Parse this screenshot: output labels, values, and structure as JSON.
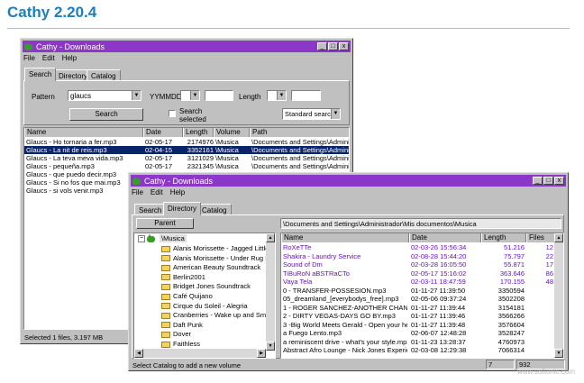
{
  "page": {
    "title": "Cathy 2.20.4",
    "watermark": "www.softonic.com"
  },
  "win1": {
    "title": "Cathy - Downloads",
    "menu": [
      "File",
      "Edit",
      "Help"
    ],
    "tabs": [
      "Search",
      "Directory",
      "Catalog"
    ],
    "search": {
      "pattern_label": "Pattern",
      "pattern_value": "glaucs",
      "date_label": "YYMMDD",
      "length_label": "Length",
      "search_button": "Search",
      "selected_label": "Search selected",
      "mode": "Standard search"
    },
    "columns": [
      "Name",
      "Date",
      "Length",
      "Volume",
      "Path"
    ],
    "rows": [
      {
        "name": "Glaucs - Ho tornaria a fer.mp3",
        "date": "02-05-17",
        "length": "2174976",
        "volume": "\\Musica",
        "path": "\\Documents and Settings\\Administr",
        "selected": false
      },
      {
        "name": "Glaucs - La nit de reis.mp3",
        "date": "02-04-15",
        "length": "3352161",
        "volume": "\\Musica",
        "path": "\\Documents and Settings\\Administr",
        "selected": true
      },
      {
        "name": "Glaucs - La teva meva vida.mp3",
        "date": "02-05-17",
        "length": "3121029",
        "volume": "\\Musica",
        "path": "\\Documents and Settings\\Administr",
        "selected": false
      },
      {
        "name": "Glaucs - pequeña.mp3",
        "date": "02-05-17",
        "length": "2321345",
        "volume": "\\Musica",
        "path": "\\Documents and Settings\\Administr",
        "selected": false
      },
      {
        "name": "Glaucs - que puedo decir.mp3",
        "date": "",
        "length": "",
        "volume": "",
        "path": "",
        "selected": false
      },
      {
        "name": "Glaucs - Si no fos que mai.mp3",
        "date": "",
        "length": "",
        "volume": "",
        "path": "",
        "selected": false
      },
      {
        "name": "Glaucs - si vols venir.mp3",
        "date": "",
        "length": "",
        "volume": "",
        "path": "",
        "selected": false
      }
    ],
    "status": "Selected 1 files, 3.197 MB"
  },
  "win2": {
    "title": "Cathy - Downloads",
    "menu": [
      "File",
      "Edit",
      "Help"
    ],
    "tabs": [
      "Search",
      "Directory",
      "Catalog"
    ],
    "parent_button": "Parent",
    "path": "\\Documents and Settings\\Administrador\\Mis documentos\\Musica",
    "tree_root": "\\Musica",
    "tree": [
      "Alanis Morissette - Jagged Little Pill",
      "Alanis Morissette - Under Rug Swept",
      "American Beauty Soundtrack",
      "Berlin2001",
      "Bridget Jones Soundtrack",
      "Café Quijano",
      "Cirque du Soleil - Alegria",
      "Cranberries - Wake up and Smell the",
      "Daft Punk",
      "Dover",
      "Faithless"
    ],
    "columns": [
      "Name",
      "Date",
      "Length",
      "Files"
    ],
    "rows": [
      {
        "name": "RoXeTTe",
        "date": "02-03-26 15:56:34",
        "length": "51.216",
        "files": "12",
        "dir": true
      },
      {
        "name": "Shakira - Laundry Service",
        "date": "02-08-28 15:44:20",
        "length": "75.797",
        "files": "22",
        "dir": true
      },
      {
        "name": "Sound of Dm",
        "date": "02-03-28 16:05:50",
        "length": "55.871",
        "files": "17",
        "dir": true
      },
      {
        "name": "TiBuRoN aBSTRaCTo",
        "date": "02-05-17 15:16:02",
        "length": "363.646",
        "files": "86",
        "dir": true
      },
      {
        "name": "Vaya Tela",
        "date": "02-03-11 18:47:59",
        "length": "170.155",
        "files": "48",
        "dir": true
      },
      {
        "name": "0 - TRANSFER-POSSESION.mp3",
        "date": "01-11-27 11:39:50",
        "length": "3350594",
        "files": "",
        "dir": false
      },
      {
        "name": "05_dreamland_[everybodys_free].mp3",
        "date": "02-05-06 09:37:24",
        "length": "3502208",
        "files": "",
        "dir": false
      },
      {
        "name": "1 - ROGER SANCHEZ-ANOTHER CHANC...",
        "date": "01-11-27 11:39:44",
        "length": "3154181",
        "files": "",
        "dir": false
      },
      {
        "name": "2 - DIRTY VEGAS-DAYS GO BY.mp3",
        "date": "01-11-27 11:39:46",
        "length": "3566266",
        "files": "",
        "dir": false
      },
      {
        "name": "3 -Big World Meets Gerald - Open your he",
        "date": "01-11-27 11:39:48",
        "length": "3576604",
        "files": "",
        "dir": false
      },
      {
        "name": "a Fuego Lento.mp3",
        "date": "02-06-07 12:48:28",
        "length": "3528247",
        "files": "",
        "dir": false
      },
      {
        "name": "a reminiscent drive - what's your style.mp3",
        "date": "01-11-23 13:28:37",
        "length": "4760973",
        "files": "",
        "dir": false
      },
      {
        "name": "Abstract Afro Lounge - Nick Jones Experie...",
        "date": "02-03-08 12:29:38",
        "length": "7066314",
        "files": "",
        "dir": false
      }
    ],
    "status": "Select Catalog to add a new volume",
    "status_count": "7",
    "status_total": "932"
  }
}
